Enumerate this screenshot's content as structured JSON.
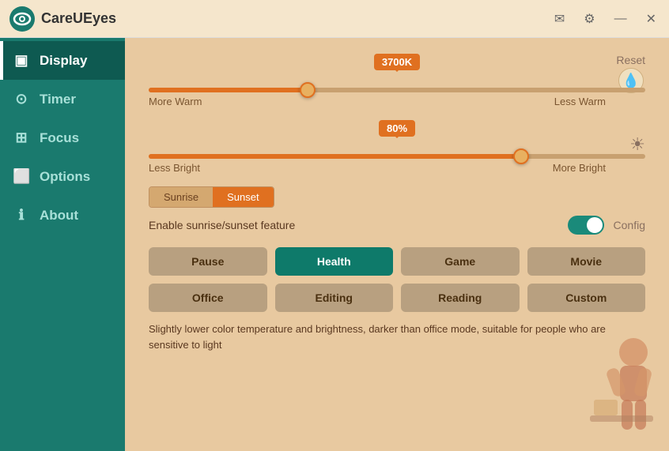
{
  "app": {
    "title": "CareUEyes",
    "logo_symbol": "👁"
  },
  "titlebar": {
    "email_icon": "✉",
    "settings_icon": "⚙",
    "minimize_icon": "—",
    "close_icon": "✕"
  },
  "sidebar": {
    "items": [
      {
        "id": "display",
        "label": "Display",
        "icon": "▣",
        "active": true
      },
      {
        "id": "timer",
        "label": "Timer",
        "icon": "⏰",
        "active": false
      },
      {
        "id": "focus",
        "label": "Focus",
        "icon": "⊞",
        "active": false
      },
      {
        "id": "options",
        "label": "Options",
        "icon": "⬜",
        "active": false
      },
      {
        "id": "about",
        "label": "About",
        "icon": "ℹ",
        "active": false
      }
    ]
  },
  "display": {
    "temperature": {
      "value": "3700K",
      "fill_percent": 32,
      "thumb_percent": 32,
      "label_left": "More Warm",
      "label_right": "Less Warm",
      "reset_label": "Reset",
      "reset_icon": "💧"
    },
    "brightness": {
      "value": "80%",
      "fill_percent": 75,
      "thumb_percent": 75,
      "label_left": "Less Bright",
      "label_right": "More Bright",
      "icon": "☀"
    },
    "sunrise": {
      "tabs": [
        {
          "label": "Sunrise",
          "active": false
        },
        {
          "label": "Sunset",
          "active": true
        }
      ],
      "toggle_label": "Enable sunrise/sunset feature",
      "toggle_on": true,
      "config_label": "Config"
    },
    "presets": {
      "row1": [
        {
          "label": "Pause",
          "active": false
        },
        {
          "label": "Health",
          "active": true
        },
        {
          "label": "Game",
          "active": false
        },
        {
          "label": "Movie",
          "active": false
        }
      ],
      "row2": [
        {
          "label": "Office",
          "active": false
        },
        {
          "label": "Editing",
          "active": false
        },
        {
          "label": "Reading",
          "active": false
        },
        {
          "label": "Custom",
          "active": false
        }
      ]
    },
    "description": "Slightly lower color temperature and brightness, darker than office mode, suitable for people who are sensitive to light"
  }
}
